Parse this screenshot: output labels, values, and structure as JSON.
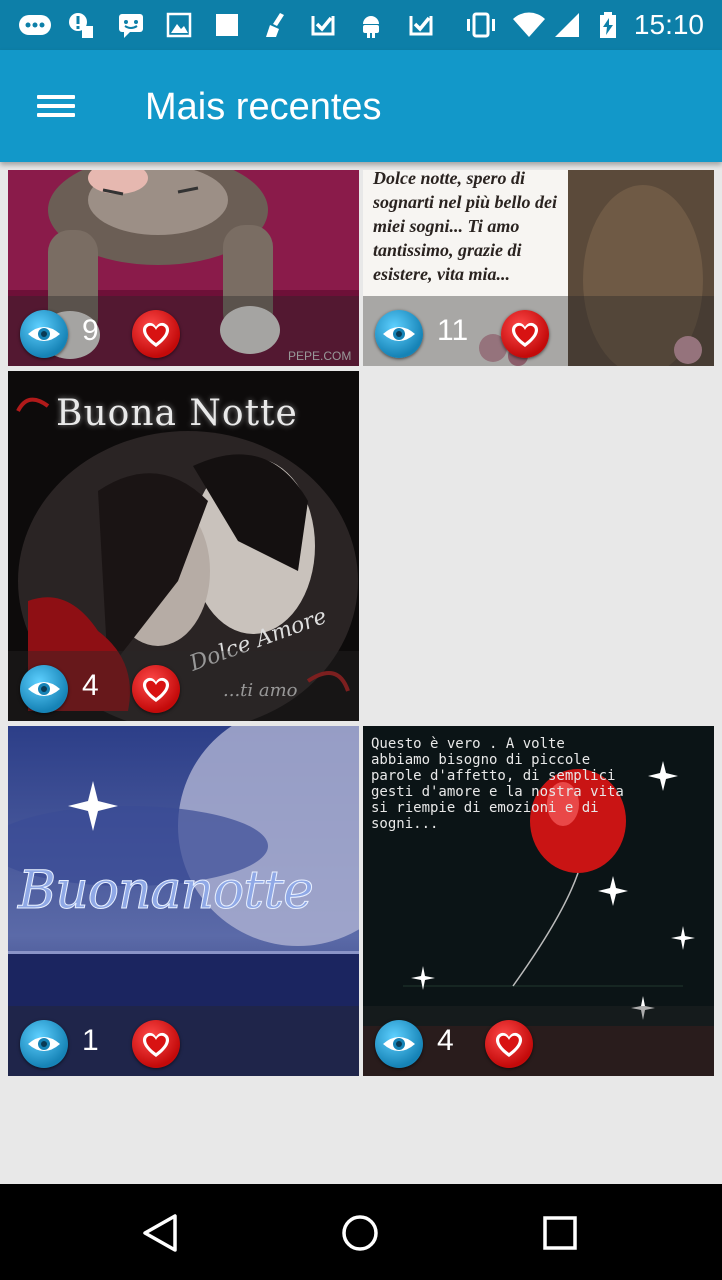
{
  "status_bar": {
    "time": "15:10",
    "icons": [
      "messenger-icon",
      "alert-icon",
      "cleaner-icon",
      "chat-icon",
      "image-icon",
      "square-icon",
      "broom-icon",
      "check-app-icon",
      "android-icon",
      "check-app-icon",
      "vibrate-icon",
      "wifi-icon",
      "signal-icon",
      "battery-charging-icon"
    ]
  },
  "app_bar": {
    "title": "Mais recentes",
    "menu_icon": "hamburger-menu-icon"
  },
  "grid": {
    "items": [
      {
        "views": "9",
        "image_text": ""
      },
      {
        "views": "11",
        "image_text": "Dolce notte, spero di sognarti nel più bello dei miei sogni... Ti amo tantissimo, grazie di esistere, vita mia..."
      },
      {
        "views": "4",
        "image_text": "Buona Notte"
      },
      {
        "views": "1",
        "image_text": "Buonanotte"
      },
      {
        "views": "4",
        "image_text": "Questo è vero . A volte abbiamo bisogno di piccole parole d'affetto, di semplici gesti d'amore e la nostra vita si riempie di emozioni e di sogni..."
      }
    ]
  },
  "nav_bar": {
    "back_icon": "back-triangle-icon",
    "home_icon": "home-circle-icon",
    "recents_icon": "recents-square-icon"
  },
  "colors": {
    "status_bar": "#0d7fa8",
    "app_bar": "#1298c9",
    "background": "#e8e8e8",
    "eye_badge": "#1683b6",
    "heart_badge": "#c30a0a"
  }
}
